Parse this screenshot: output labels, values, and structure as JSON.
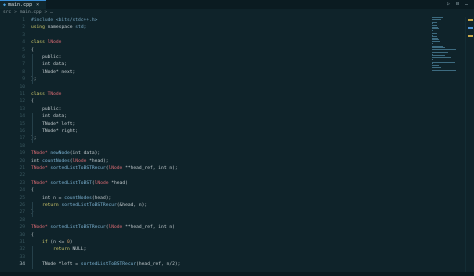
{
  "tab": {
    "icon": "C++",
    "label": "main.cpp",
    "close": "×"
  },
  "toolbar": {
    "run": "▷",
    "split": "⊟",
    "more": "…"
  },
  "breadcrumb": [
    "src",
    ">",
    "main.cpp",
    ">",
    "…"
  ],
  "colors": {
    "keyword": "#d7d06e",
    "type": "#e06c75",
    "function": "#7fb7d8",
    "text": "#c9d1d4"
  },
  "lines": [
    {
      "n": "1",
      "t": [
        [
          "pp",
          "#include <bits/stdc++.h>"
        ]
      ]
    },
    {
      "n": "2",
      "t": [
        [
          "kw",
          "using "
        ],
        [
          "txt",
          "namespace "
        ],
        [
          "pp",
          "std;"
        ]
      ]
    },
    {
      "n": "3",
      "t": []
    },
    {
      "n": "4",
      "t": [
        [
          "kw",
          "class "
        ],
        [
          "type",
          "lNode"
        ]
      ]
    },
    {
      "n": "5",
      "t": [
        [
          "txt",
          "{"
        ]
      ]
    },
    {
      "n": "6",
      "t": [
        [
          "txt",
          "    public:"
        ]
      ]
    },
    {
      "n": "7",
      "t": [
        [
          "txt",
          "    int data;"
        ]
      ]
    },
    {
      "n": "8",
      "t": [
        [
          "txt",
          "    lNode* next;"
        ]
      ]
    },
    {
      "n": "9",
      "t": [
        [
          "txt",
          "};"
        ]
      ]
    },
    {
      "n": "10",
      "t": []
    },
    {
      "n": "11",
      "t": [
        [
          "kw",
          "class "
        ],
        [
          "type",
          "TNode"
        ]
      ]
    },
    {
      "n": "12",
      "t": [
        [
          "txt",
          "{"
        ]
      ]
    },
    {
      "n": "13",
      "t": [
        [
          "txt",
          "    public:"
        ]
      ]
    },
    {
      "n": "14",
      "t": [
        [
          "txt",
          "    int data;"
        ]
      ]
    },
    {
      "n": "15",
      "t": [
        [
          "txt",
          "    TNode* left;"
        ]
      ]
    },
    {
      "n": "16",
      "t": [
        [
          "txt",
          "    TNode* right;"
        ]
      ]
    },
    {
      "n": "17",
      "t": [
        [
          "txt",
          "};"
        ]
      ]
    },
    {
      "n": "18",
      "t": []
    },
    {
      "n": "19",
      "t": [
        [
          "type",
          "TNode* "
        ],
        [
          "fn",
          "newNode"
        ],
        [
          "txt",
          "(int data);"
        ]
      ]
    },
    {
      "n": "20",
      "t": [
        [
          "txt",
          "int "
        ],
        [
          "fn",
          "countNodes"
        ],
        [
          "txt",
          "("
        ],
        [
          "type",
          "lNode "
        ],
        [
          "txt",
          "*head);"
        ]
      ]
    },
    {
      "n": "21",
      "t": [
        [
          "type",
          "TNode* "
        ],
        [
          "fn",
          "sortedListToBSTRecur"
        ],
        [
          "txt",
          "("
        ],
        [
          "type",
          "lNode "
        ],
        [
          "txt",
          "**head_ref, int n);"
        ]
      ]
    },
    {
      "n": "22",
      "t": []
    },
    {
      "n": "23",
      "t": [
        [
          "type",
          "TNode* "
        ],
        [
          "fn",
          "sortedListToBST"
        ],
        [
          "txt",
          "("
        ],
        [
          "type",
          "lNode "
        ],
        [
          "txt",
          "*head)"
        ]
      ]
    },
    {
      "n": "24",
      "t": [
        [
          "txt",
          "{"
        ]
      ]
    },
    {
      "n": "25",
      "t": [
        [
          "txt",
          "    int n = "
        ],
        [
          "fn",
          "countNodes"
        ],
        [
          "txt",
          "(head);"
        ]
      ]
    },
    {
      "n": "26",
      "t": [
        [
          "kw",
          "    return "
        ],
        [
          "fn",
          "sortedListToBSTRecur"
        ],
        [
          "txt",
          "(&head, n);"
        ]
      ]
    },
    {
      "n": "27",
      "t": [
        [
          "txt",
          "}"
        ]
      ]
    },
    {
      "n": "28",
      "t": []
    },
    {
      "n": "29",
      "t": [
        [
          "type",
          "TNode* "
        ],
        [
          "fn",
          "sortedListToBSTRecur"
        ],
        [
          "txt",
          "("
        ],
        [
          "type",
          "lNode "
        ],
        [
          "txt",
          "**head_ref, int n)"
        ]
      ]
    },
    {
      "n": "30",
      "t": [
        [
          "txt",
          "{"
        ]
      ]
    },
    {
      "n": "31",
      "t": [
        [
          "kw",
          "    if "
        ],
        [
          "txt",
          "(n <= "
        ],
        [
          "num",
          "0"
        ],
        [
          "txt",
          ")"
        ]
      ]
    },
    {
      "n": "32",
      "t": [
        [
          "kw",
          "        return "
        ],
        [
          "txt",
          "NULL;"
        ]
      ]
    },
    {
      "n": "33",
      "t": []
    },
    {
      "n": "34",
      "t": [
        [
          "txt",
          "    TNode *left = "
        ],
        [
          "fn",
          "sortedListToBSTRecur"
        ],
        [
          "txt",
          "(head_ref, n/2);"
        ]
      ]
    }
  ],
  "active_line": "34"
}
